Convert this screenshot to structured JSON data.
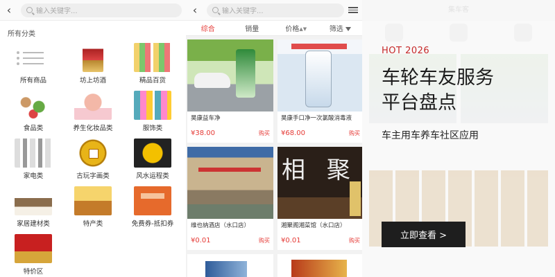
{
  "left": {
    "search_placeholder": "输入关键字...",
    "section_title": "所有分类",
    "categories": [
      {
        "label": "所有商品",
        "icon": "list-icon"
      },
      {
        "label": "坊上坊酒",
        "icon": "wine-bottle-icon"
      },
      {
        "label": "精品百货",
        "icon": "goods-icon"
      },
      {
        "label": "食品类",
        "icon": "food-icon"
      },
      {
        "label": "养生化妆品类",
        "icon": "cosmetics-icon"
      },
      {
        "label": "服饰类",
        "icon": "clothing-icon"
      },
      {
        "label": "家电类",
        "icon": "appliance-icon"
      },
      {
        "label": "古玩字画类",
        "icon": "coin-icon"
      },
      {
        "label": "风水运程类",
        "icon": "yinyang-icon"
      },
      {
        "label": "家居建材类",
        "icon": "furniture-icon"
      },
      {
        "label": "特产类",
        "icon": "specialty-icon"
      },
      {
        "label": "免费券-抵扣券",
        "icon": "coupon-icon"
      },
      {
        "label": "特价区",
        "icon": "sale-icon"
      }
    ]
  },
  "middle": {
    "search_placeholder": "输入关键字...",
    "tabs": [
      "综合",
      "销量",
      "价格",
      "筛选"
    ],
    "buy_label": "购买",
    "products": [
      {
        "name": "昊康益车净",
        "price": "¥38.00"
      },
      {
        "name": "昊康手口净一次氯酸消毒液",
        "price": "¥68.00"
      },
      {
        "name": "维也纳酒店（水口店）",
        "price": "¥0.01"
      },
      {
        "name": "湘聚阁湘菜馆（水口店）",
        "price": "¥0.01"
      }
    ]
  },
  "banner": {
    "tag": "HOT 2026",
    "headline": "车轮车友服务平台盘点",
    "subtitle": "车主用车养车社区应用",
    "cta": "立即查看 >",
    "ghost_title": "集车客",
    "accent": "#c62828",
    "cta_bg": "#1e1e1e"
  }
}
